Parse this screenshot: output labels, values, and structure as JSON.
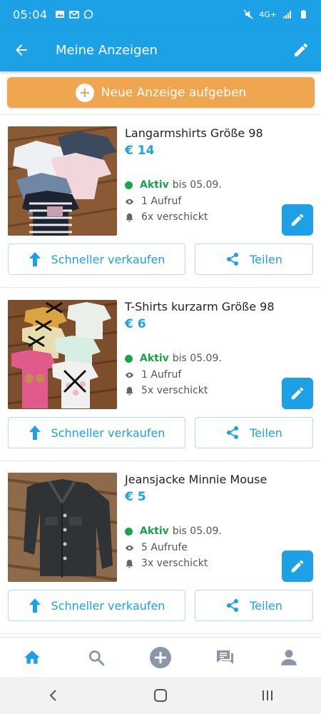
{
  "status_bar": {
    "time": "05:04",
    "network": "4G+"
  },
  "app_bar": {
    "title": "Meine Anzeigen"
  },
  "new_ad": {
    "label": "Neue Anzeige aufgeben"
  },
  "listings": [
    {
      "title": "Langarmshirts Größe 98",
      "price": "€ 14",
      "status": "Aktiv",
      "until": "bis 05.09.",
      "views": "1 Aufruf",
      "sent": "6x verschickt",
      "boost_label": "Schneller verkaufen",
      "share_label": "Teilen"
    },
    {
      "title": "T-Shirts kurzarm Größe 98",
      "price": "€ 6",
      "status": "Aktiv",
      "until": "bis 05.09.",
      "views": "1 Aufruf",
      "sent": "5x verschickt",
      "boost_label": "Schneller verkaufen",
      "share_label": "Teilen"
    },
    {
      "title": "Jeansjacke Minnie Mouse",
      "price": "€ 5",
      "status": "Aktiv",
      "until": "bis 05.09.",
      "views": "5 Aufrufe",
      "sent": "3x verschickt",
      "boost_label": "Schneller verkaufen",
      "share_label": "Teilen"
    }
  ],
  "colors": {
    "primary": "#1da1e6",
    "accent": "#f0a64e",
    "active": "#1aa34a"
  },
  "icons": [
    "arrow-back-icon",
    "pencil-icon",
    "plus-icon",
    "eye-icon",
    "bell-icon",
    "arrow-up-icon",
    "share-icon",
    "home-icon",
    "search-icon",
    "add-circle-icon",
    "chat-icon",
    "person-icon"
  ]
}
